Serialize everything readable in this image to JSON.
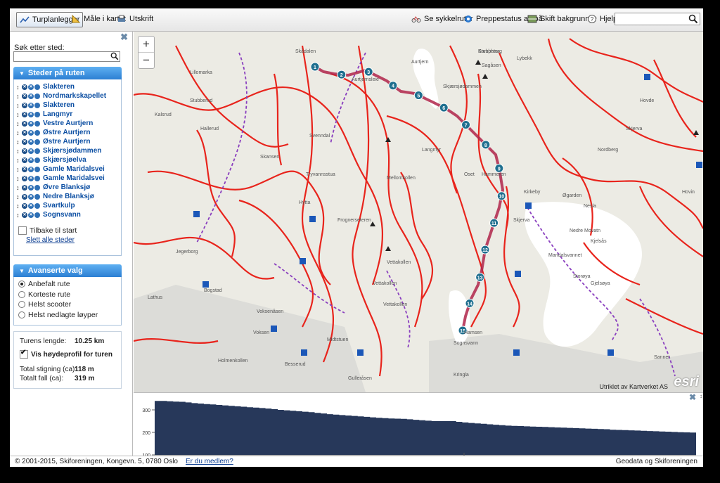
{
  "toolbar": {
    "planner_label": "Turplanlegger",
    "measure_label": "Måle i kartet",
    "print_label": "Utskrift",
    "bike_routes_label": "Se sykkelruter",
    "grooming_label": "Preppestatus av/på",
    "background_label": "Skift bakgrunn",
    "help_label": "Hjelp",
    "search_value": ""
  },
  "sidebar": {
    "search_label": "Søk etter sted:",
    "search_value": "",
    "places_header": "Steder på ruten",
    "stops": [
      "Slakteren",
      "Nordmarkskapellet",
      "Slakteren",
      "Langmyr",
      "Vestre Aurtjern",
      "Østre Aurtjern",
      "Østre Aurtjern",
      "Skjærsjødammen",
      "Skjærsjøelva",
      "Gamle Maridalsvei",
      "Gamle Maridalsvei",
      "Øvre Blanksjø",
      "Nedre Blanksjø",
      "Svartkulp",
      "Sognsvann"
    ],
    "back_to_start_label": "Tilbake til start",
    "back_to_start_checked": false,
    "clear_all_label": "Slett alle steder",
    "advanced_header": "Avanserte valg",
    "route_options": [
      "Anbefalt rute",
      "Korteste rute",
      "Helst scooter",
      "Helst nedlagte løyper"
    ],
    "selected_option": 0,
    "length_label": "Turens lengde:",
    "length_value": "10.25 km",
    "show_profile_label": "Vis høydeprofil for turen",
    "show_profile_checked": true,
    "climb_label": "Total stigning (ca):",
    "climb_value": "118 m",
    "fall_label": "Totalt fall (ca):",
    "fall_value": "319 m"
  },
  "map": {
    "credits": "Utriklet av Kartverket AS",
    "logo": "esri",
    "place_labels": [
      "Kamphaug",
      "Sagåsen",
      "Lybekk",
      "Skjærsjødammen",
      "Aurtjernsleie",
      "Aurtjern",
      "Langmyr",
      "Tryvannsstua",
      "Mellomkollen",
      "Stubberud",
      "Kalsrud",
      "Hallerud",
      "Hytta",
      "Frognerseteren",
      "Vettakollen",
      "Holmenkollen",
      "Voksenåsen",
      "Besserud",
      "Gulleråsen",
      "Skådalen",
      "Midtstuen",
      "Vettakollen",
      "Vettakollen",
      "Sognsvann",
      "Hammeren",
      "Kirkeby",
      "Øgarden",
      "Nesla",
      "Nedre Movatn",
      "Maridalsvannet",
      "Storøya",
      "Gjelsøya",
      "Skjerva",
      "Jegerborg",
      "Bogstad",
      "Lathus",
      "Voksen",
      "Hamsen",
      "Kringla",
      "Nordberg",
      "Sanner",
      "Kjelsås",
      "Hovde",
      "Svenndal",
      "Oset",
      "Skjerva",
      "Hovin",
      "Skansen",
      "Lillomarka",
      "Stubbetor"
    ],
    "route_markers": [
      "1",
      "2",
      "3",
      "4",
      "5",
      "6",
      "7",
      "8",
      "9",
      "10",
      "11",
      "12",
      "13",
      "14",
      "15"
    ]
  },
  "profile": {
    "y_ticks": [
      "300",
      "200",
      "100"
    ]
  },
  "chart_data": {
    "type": "area",
    "title": "",
    "xlabel": "",
    "ylabel": "",
    "ylim": [
      100,
      350
    ],
    "series": [
      {
        "values": [
          340,
          340,
          338,
          337,
          336,
          333,
          330,
          328,
          326,
          324,
          322,
          320,
          318,
          316,
          314,
          312,
          310,
          308,
          306,
          303,
          300,
          298,
          296,
          294,
          292,
          290,
          287,
          284,
          281,
          279,
          277,
          275,
          273,
          271,
          269,
          267,
          265,
          263,
          262,
          261,
          260,
          258,
          256,
          254,
          252,
          250,
          250,
          250,
          250,
          247,
          244,
          242,
          240,
          238,
          236,
          234,
          232,
          230,
          229,
          228,
          227,
          226,
          225,
          224,
          223,
          222,
          221,
          220,
          219,
          218,
          217,
          216,
          215,
          214,
          212,
          211,
          210,
          209,
          208,
          207,
          206,
          205,
          204,
          203,
          202,
          201,
          200,
          199
        ]
      }
    ]
  },
  "footer": {
    "copyright": "© 2001-2015, Skiforeningen, Kongevn. 5, 0780 Oslo",
    "member_link": "Er du medlem?",
    "right_text": "Geodata og Skiforeningen"
  }
}
